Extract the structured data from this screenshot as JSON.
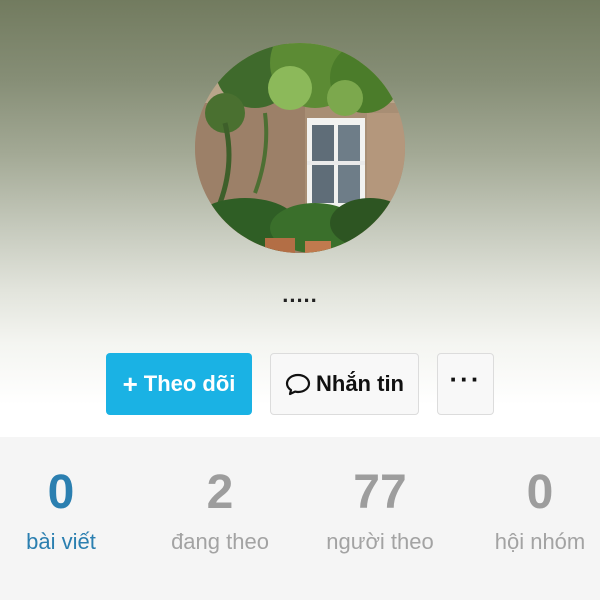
{
  "profile": {
    "display_name": "....."
  },
  "actions": {
    "follow_label": "Theo dõi",
    "message_label": "Nhắn tin",
    "more_label": "···"
  },
  "stats": [
    {
      "value": "0",
      "label": "bài viết"
    },
    {
      "value": "2",
      "label": "đang theo"
    },
    {
      "value": "77",
      "label": "người theo"
    },
    {
      "value": "0",
      "label": "hội nhóm"
    }
  ],
  "colors": {
    "accent": "#1ab2e4",
    "active_stat": "#2b7fb0",
    "inactive_stat": "#9d9d9d"
  }
}
